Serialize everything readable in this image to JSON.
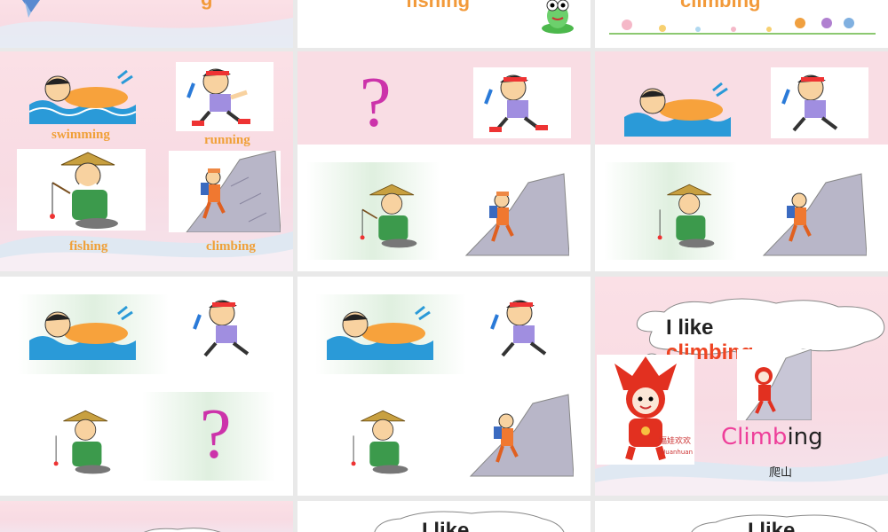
{
  "slides_row0": {
    "s1_word": "g",
    "s2_word": "fishing",
    "s3_word": "climbing"
  },
  "slide_labels": {
    "swimming": "swimming",
    "running": "running",
    "fishing": "fishing",
    "climbing": "climbing"
  },
  "question_mark": "?",
  "climb_slide": {
    "sentence_start": "I like",
    "sentence_word": "climbing",
    "sentence_end": ".",
    "word_pink": "Climb",
    "word_black": "ing",
    "chinese": "爬山",
    "badge_text": "福娃欢欢",
    "badge_sub": "Huanhuan"
  },
  "row3": {
    "s2_text": "I like",
    "s3_text": "I like"
  },
  "colors": {
    "pink_bg": "#f8dbe3",
    "label_orange": "#f0a038",
    "question_magenta": "#cc33aa",
    "red_word": "#ee4422",
    "pink_word": "#ee3f9a"
  }
}
